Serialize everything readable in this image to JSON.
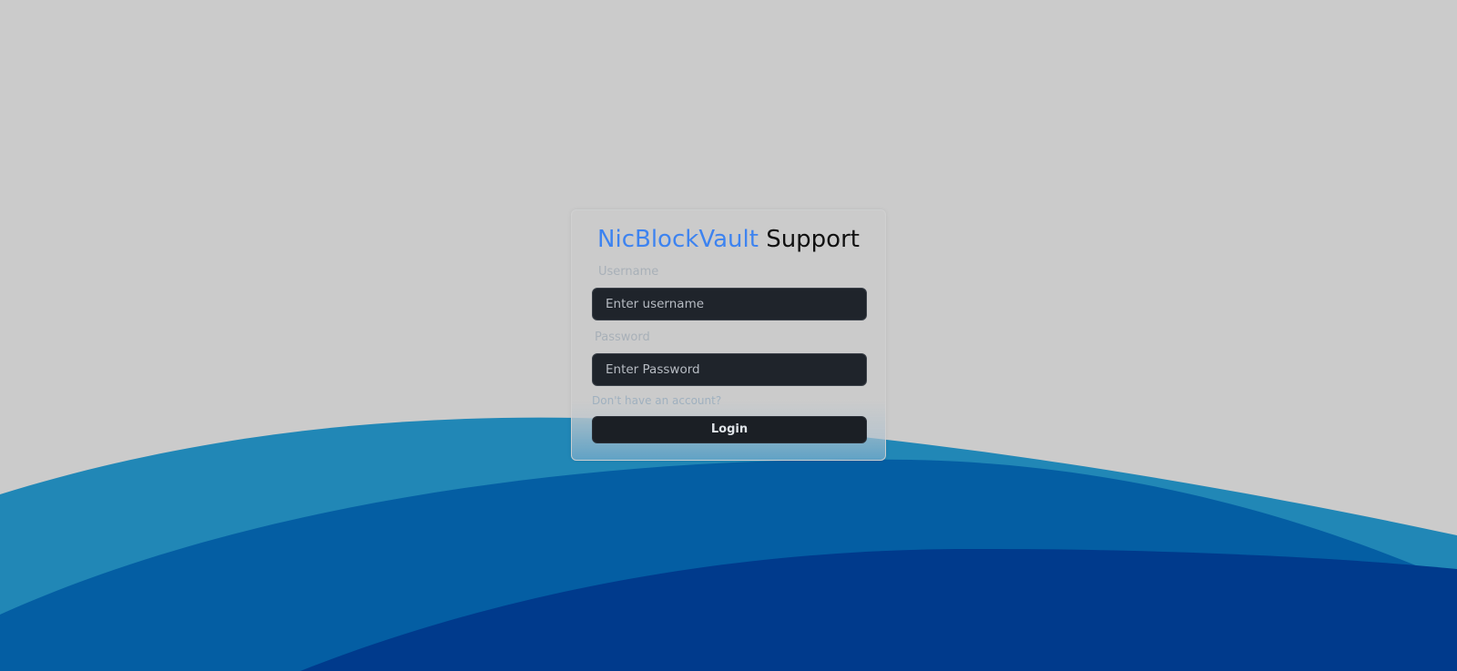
{
  "header": {
    "brand": "NicBlockVault",
    "suffix": "Support"
  },
  "form": {
    "username_label": "Username",
    "username_placeholder": "Enter username",
    "username_value": "",
    "password_label": "Password",
    "password_placeholder": "Enter Password",
    "password_value": "",
    "signup_link": "Don't have an account?",
    "login_button": "Login"
  },
  "colors": {
    "background": "#cbcbcb",
    "brand": "#3d83f0",
    "wave_light": "#2187b6",
    "wave_mid": "#045ea3",
    "wave_dark": "#003a8c",
    "input_bg": "#1f242b"
  }
}
